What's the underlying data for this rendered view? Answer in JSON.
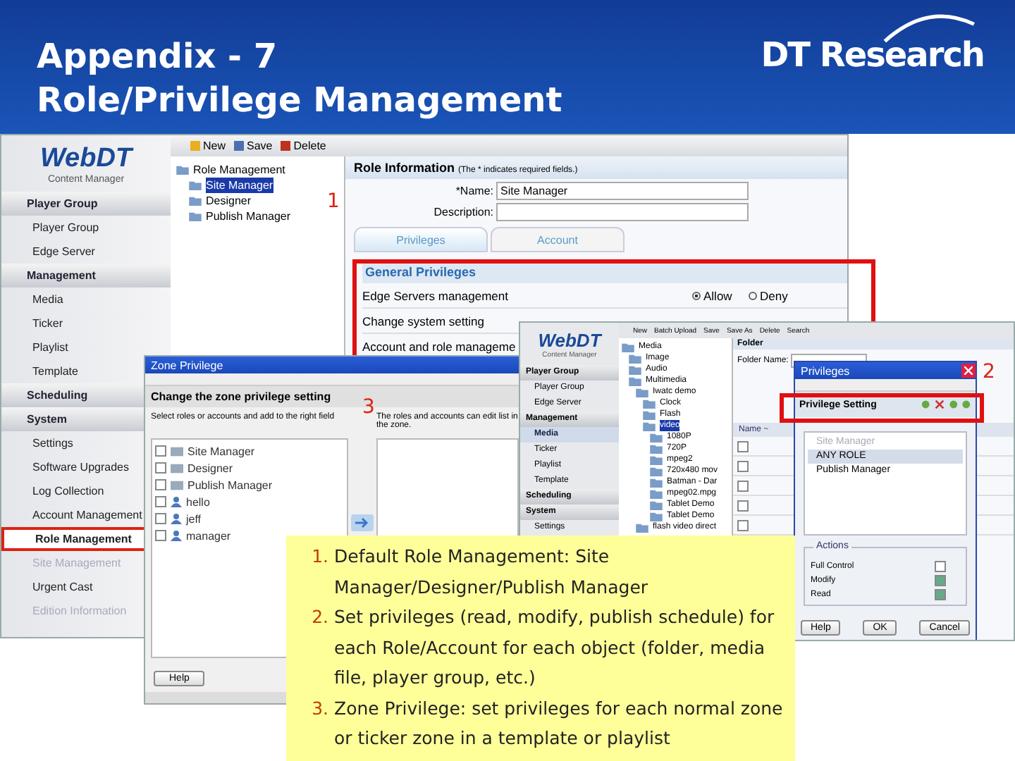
{
  "slide": {
    "title_lines": [
      "Appendix - 7",
      "Role/Privilege Management"
    ],
    "logo": "DT Research"
  },
  "main_window": {
    "logo": {
      "brand": "WebDT",
      "subtitle": "Content Manager"
    },
    "sidebar": [
      {
        "label": "Player Group",
        "items": [
          {
            "label": "Player Group",
            "selected": false,
            "disabled": false
          },
          {
            "label": "Edge Server",
            "selected": false,
            "disabled": false
          }
        ]
      },
      {
        "label": "Management",
        "items": [
          {
            "label": "Media",
            "selected": false,
            "disabled": false
          },
          {
            "label": "Ticker",
            "selected": false,
            "disabled": false
          },
          {
            "label": "Playlist",
            "selected": false,
            "disabled": false
          },
          {
            "label": "Template",
            "selected": false,
            "disabled": false
          }
        ]
      },
      {
        "label": "Scheduling"
      },
      {
        "label": "System",
        "items": [
          {
            "label": "Settings",
            "selected": false,
            "disabled": false
          },
          {
            "label": "Software Upgrades",
            "selected": false,
            "disabled": false
          },
          {
            "label": "Log Collection",
            "selected": false,
            "disabled": false
          },
          {
            "label": "Account Management",
            "selected": false,
            "disabled": false
          },
          {
            "label": "Role Management",
            "selected": true,
            "disabled": false
          },
          {
            "label": "Site Management",
            "selected": false,
            "disabled": true
          },
          {
            "label": "Urgent Cast",
            "selected": false,
            "disabled": false
          },
          {
            "label": "Edition Information",
            "selected": false,
            "disabled": true
          }
        ]
      }
    ],
    "toolbar": [
      {
        "label": "New",
        "kind": "new"
      },
      {
        "label": "Save",
        "kind": "save"
      },
      {
        "label": "Delete",
        "kind": "delete"
      }
    ],
    "tree": {
      "label": "Role Management",
      "children": [
        {
          "label": "Site Manager",
          "selected": true
        },
        {
          "label": "Designer",
          "selected": false
        },
        {
          "label": "Publish Manager",
          "selected": false
        }
      ]
    },
    "form": {
      "heading": "Role Information",
      "note": "(The * indicates required fields.)",
      "fields": [
        {
          "label": "*Name:",
          "value": "Site Manager"
        },
        {
          "label": "Description:"
        }
      ]
    },
    "tabs": [
      {
        "label": "Privileges",
        "selected": true
      },
      {
        "label": "Account",
        "selected": false
      }
    ],
    "privileges": {
      "heading": "General Privileges",
      "rows": [
        {
          "label": "Edge Servers management",
          "options": [
            {
              "label": "Allow",
              "selected": true
            },
            {
              "label": "Deny",
              "selected": false
            }
          ]
        },
        {
          "label": "Change system setting"
        },
        {
          "label": "Account and role manageme"
        }
      ]
    }
  },
  "zone_window": {
    "title": "Zone Privilege",
    "heading": "Change the zone privilege setting",
    "left_hint": "Select roles or accounts and add to the right field",
    "right_hint": "The roles and accounts can edit list in the zone.",
    "items": [
      {
        "label": "Site Manager",
        "kind": "role",
        "checked": false
      },
      {
        "label": "Designer",
        "kind": "role",
        "checked": false
      },
      {
        "label": "Publish Manager",
        "kind": "role",
        "checked": false
      },
      {
        "label": "hello",
        "kind": "account",
        "checked": false
      },
      {
        "label": "jeff",
        "kind": "account",
        "checked": false
      },
      {
        "label": "manager",
        "kind": "account",
        "checked": false
      }
    ],
    "button": "Help"
  },
  "media_window": {
    "logo": {
      "brand": "WebDT",
      "subtitle": "Content Manager"
    },
    "sidebar": [
      {
        "label": "Player Group",
        "kind": "section"
      },
      {
        "label": "Player Group",
        "kind": "item",
        "selected": false
      },
      {
        "label": "Edge Server",
        "kind": "item",
        "selected": false
      },
      {
        "label": "Management",
        "kind": "section"
      },
      {
        "label": "Media",
        "kind": "item",
        "selected": true
      },
      {
        "label": "Ticker",
        "kind": "item",
        "selected": false
      },
      {
        "label": "Playlist",
        "kind": "item",
        "selected": false
      },
      {
        "label": "Template",
        "kind": "item",
        "selected": false
      },
      {
        "label": "Scheduling",
        "kind": "section"
      },
      {
        "label": "System",
        "kind": "section"
      },
      {
        "label": "Settings",
        "kind": "item",
        "selected": false
      }
    ],
    "toolbar": [
      "New",
      "Batch Upload",
      "Save",
      "Save As",
      "Delete",
      "Search"
    ],
    "tree": {
      "label": "Media",
      "selected": false,
      "children": [
        {
          "label": "Image",
          "selected": false
        },
        {
          "label": "Audio",
          "selected": false
        },
        {
          "label": "Multimedia",
          "selected": false,
          "children": [
            {
              "label": "Iwatc demo",
              "selected": false,
              "children": [
                {
                  "label": "Clock",
                  "selected": false
                },
                {
                  "label": "Flash",
                  "selected": false
                },
                {
                  "label": "video",
                  "selected": true,
                  "children": [
                    {
                      "label": "1080P",
                      "selected": false
                    },
                    {
                      "label": "720P",
                      "selected": false
                    },
                    {
                      "label": "mpeg2",
                      "selected": false
                    },
                    {
                      "label": "720x480 mov",
                      "selected": false
                    },
                    {
                      "label": "Batman - Dar",
                      "selected": false
                    },
                    {
                      "label": "mpeg02.mpg",
                      "selected": false
                    },
                    {
                      "label": "Tablet Demo",
                      "selected": false
                    },
                    {
                      "label": "Tablet Demo",
                      "selected": false
                    }
                  ]
                }
              ]
            },
            {
              "label": "flash video direct",
              "selected": false
            }
          ]
        }
      ]
    },
    "folder_heading": "Folder",
    "folder_field": "Folder Name:",
    "name_column": "Name ~",
    "file_rows": [
      {
        "checked": false
      },
      {
        "checked": false
      },
      {
        "checked": false
      },
      {
        "checked": false
      },
      {
        "checked": false
      }
    ]
  },
  "privileges_dialog": {
    "title": "Privileges",
    "heading": "Privilege Setting",
    "roles": [
      {
        "label": "Site Manager",
        "selected": false,
        "disabled": true
      },
      {
        "label": "ANY ROLE",
        "selected": true,
        "disabled": false
      },
      {
        "label": "Publish Manager",
        "selected": false,
        "disabled": false
      }
    ],
    "actions_heading": "Actions",
    "actions": [
      {
        "label": "Full Control",
        "checked": false
      },
      {
        "label": "Modify",
        "checked": true
      },
      {
        "label": "Read",
        "checked": true
      }
    ],
    "buttons": [
      "Help",
      "OK",
      "Cancel"
    ]
  },
  "callouts": [
    "1",
    "2",
    "3"
  ],
  "notes": [
    {
      "number": "1.",
      "text": "Default Role Management: Site Manager/Designer/Publish Manager"
    },
    {
      "number": "2.",
      "text": "Set privileges (read, modify, publish schedule) for each Role/Account for each object (folder, media file, player group, etc.)"
    },
    {
      "number": "3.",
      "text": "Zone Privilege: set privileges for each normal zone or ticker zone in a template or playlist"
    }
  ]
}
